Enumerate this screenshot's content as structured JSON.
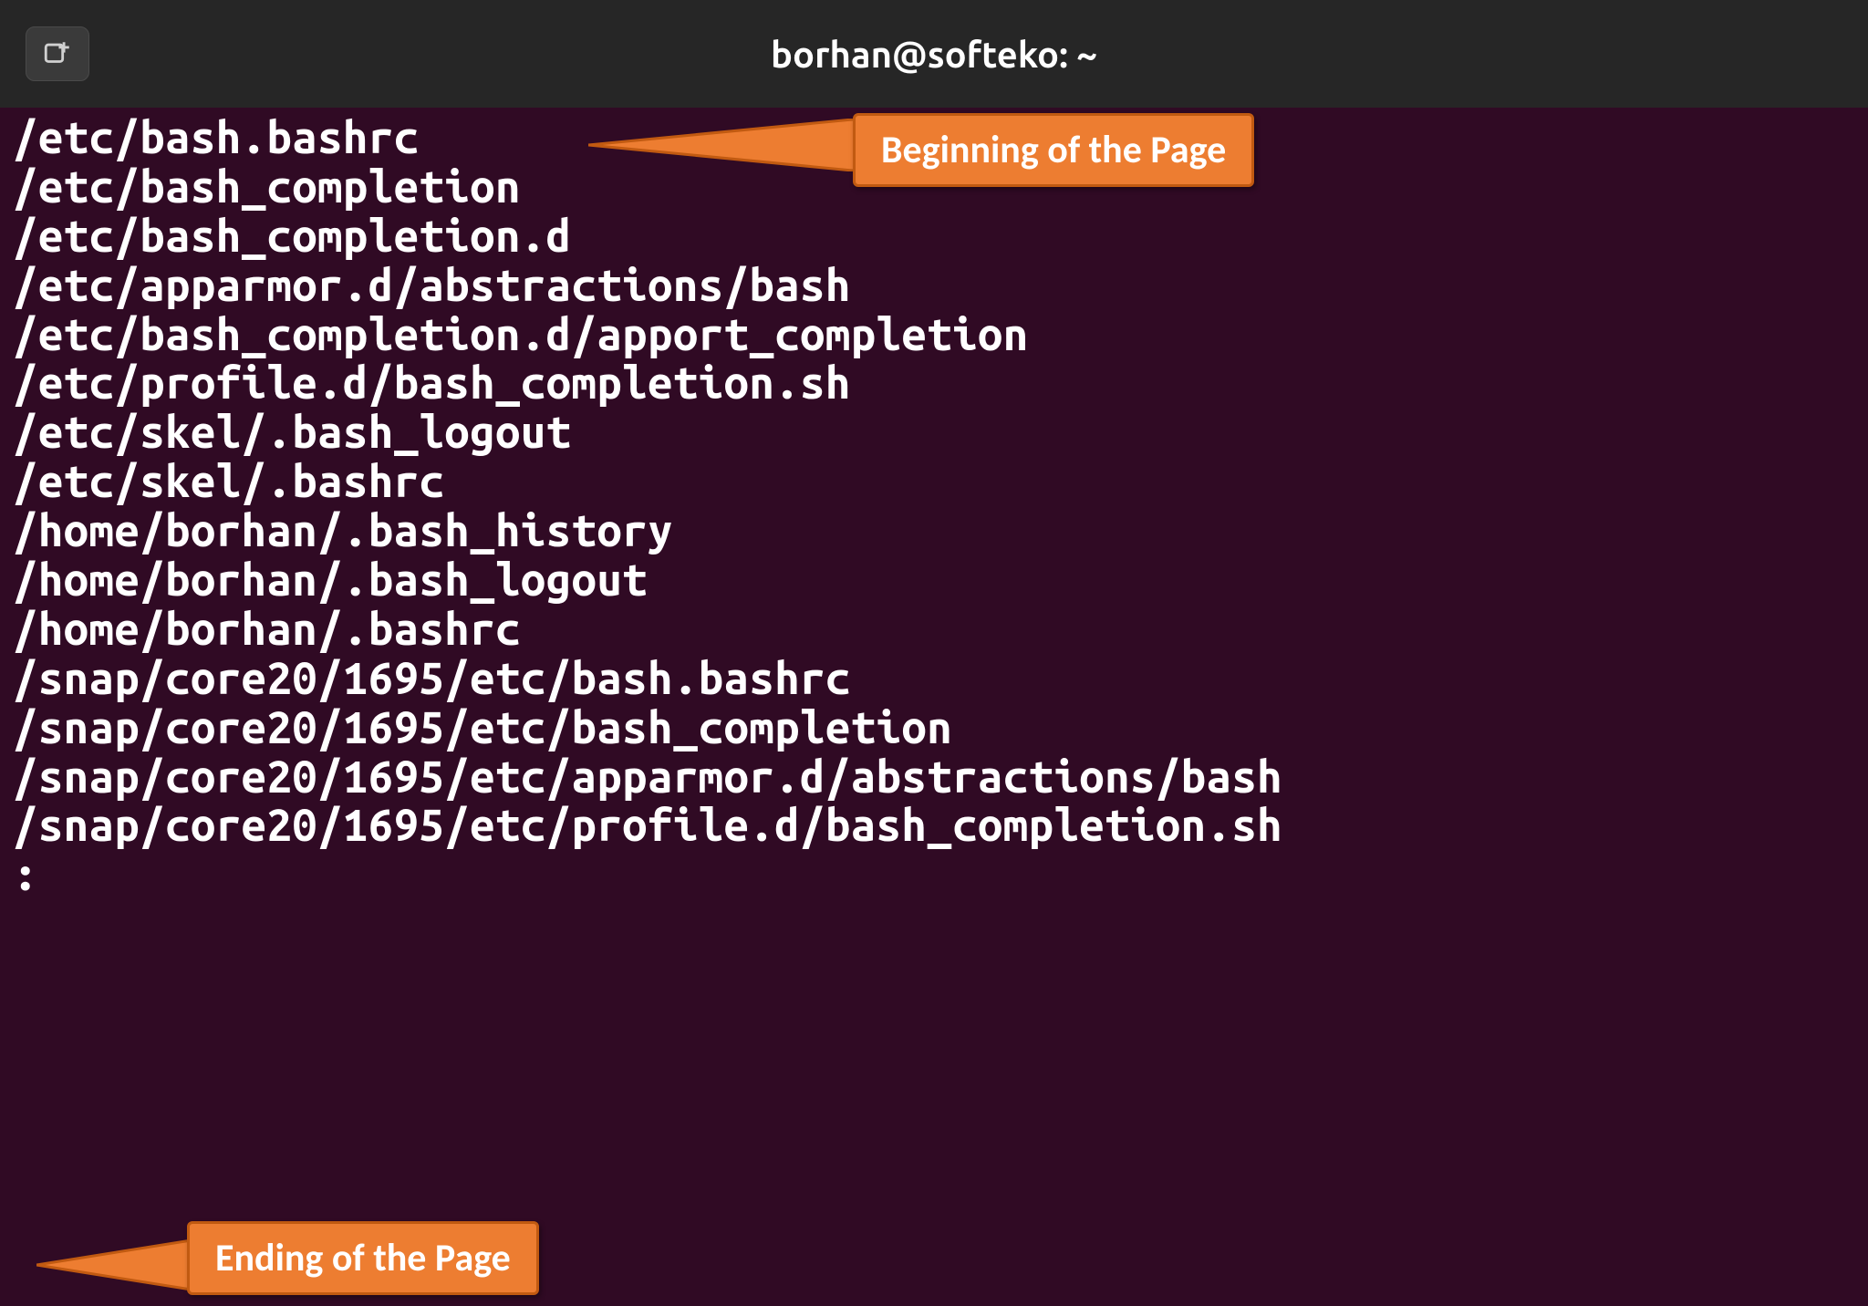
{
  "window": {
    "title": "borhan@softeko: ~"
  },
  "terminal": {
    "lines": [
      "/etc/bash.bashrc",
      "/etc/bash_completion",
      "/etc/bash_completion.d",
      "/etc/apparmor.d/abstractions/bash",
      "/etc/bash_completion.d/apport_completion",
      "/etc/profile.d/bash_completion.sh",
      "/etc/skel/.bash_logout",
      "/etc/skel/.bashrc",
      "/home/borhan/.bash_history",
      "/home/borhan/.bash_logout",
      "/home/borhan/.bashrc",
      "/snap/core20/1695/etc/bash.bashrc",
      "/snap/core20/1695/etc/bash_completion",
      "/snap/core20/1695/etc/apparmor.d/abstractions/bash",
      "/snap/core20/1695/etc/profile.d/bash_completion.sh",
      ":"
    ]
  },
  "callouts": {
    "top": "Beginning of the Page",
    "bottom": "Ending of the Page"
  },
  "colors": {
    "terminal_bg": "#300a24",
    "title_bar_bg": "#262626",
    "callout_bg": "#ed7d31",
    "callout_border": "#c15a11",
    "text": "#ffffff"
  }
}
